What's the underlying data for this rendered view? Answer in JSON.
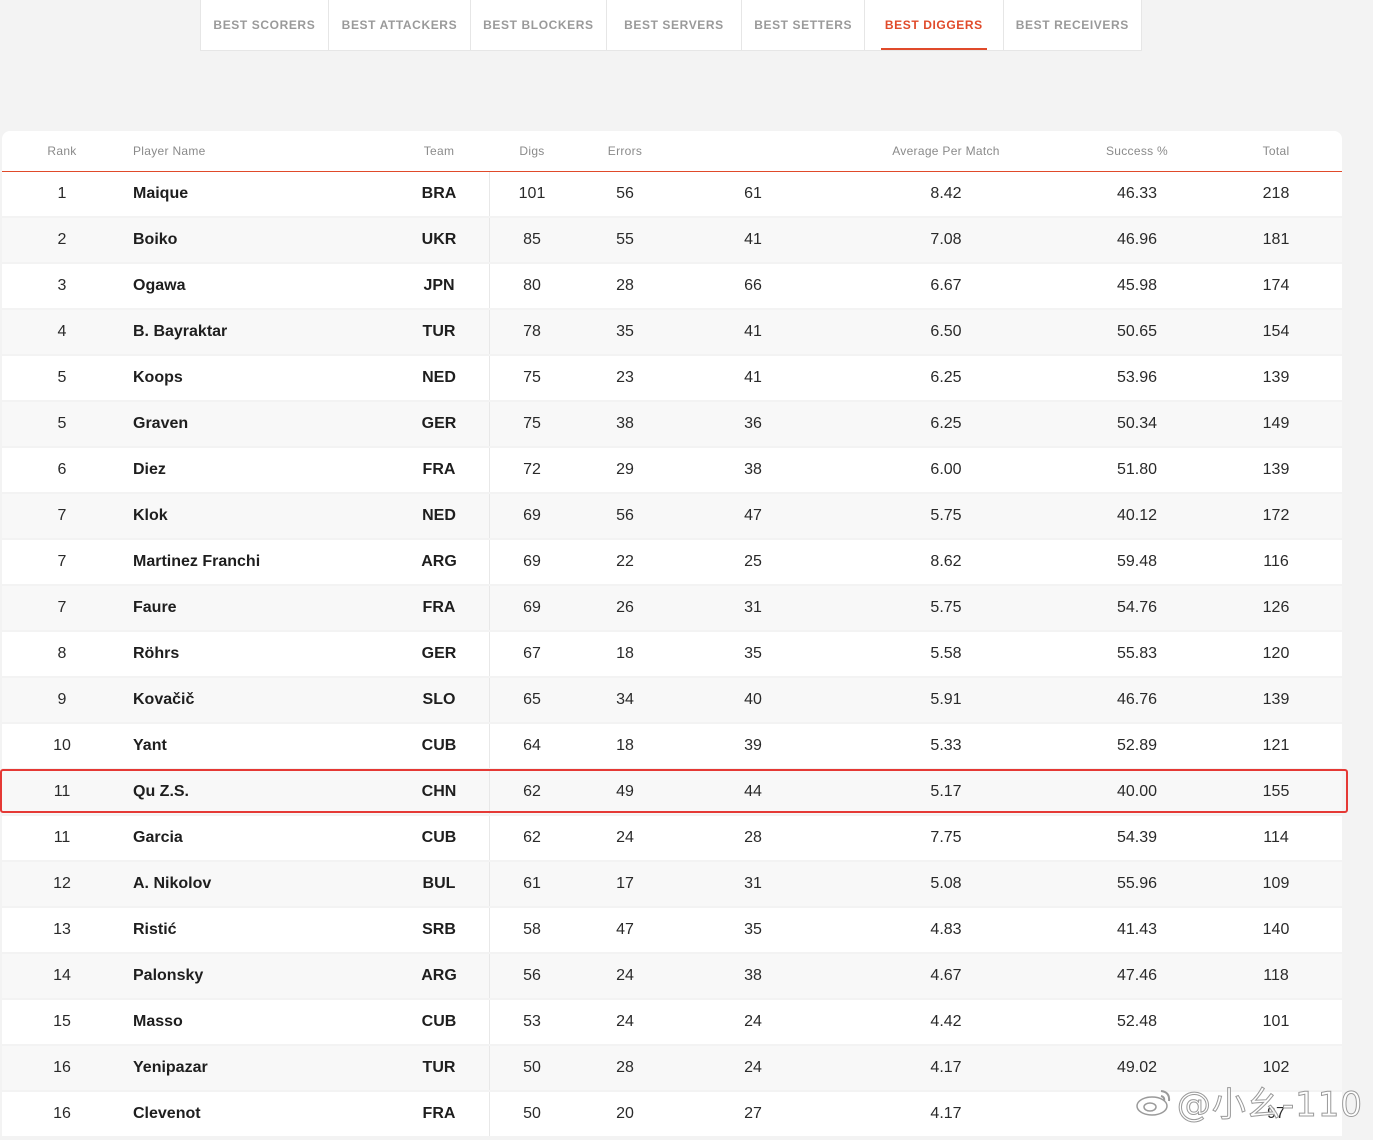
{
  "tabs": [
    {
      "label": "BEST SCORERS",
      "active": false
    },
    {
      "label": "BEST ATTACKERS",
      "active": false
    },
    {
      "label": "BEST BLOCKERS",
      "active": false
    },
    {
      "label": "BEST SERVERS",
      "active": false
    },
    {
      "label": "BEST SETTERS",
      "active": false
    },
    {
      "label": "BEST DIGGERS",
      "active": true
    },
    {
      "label": "BEST RECEIVERS",
      "active": false
    }
  ],
  "table": {
    "headers": {
      "rank": "Rank",
      "player": "Player Name",
      "team": "Team",
      "digs": "Digs",
      "errors": "Errors",
      "blurred": "",
      "avg": "Average Per Match",
      "success": "Success %",
      "total": "Total"
    },
    "rows": [
      {
        "rank": "1",
        "player": "Maique",
        "team": "BRA",
        "digs": "101",
        "errors": "56",
        "x": "61",
        "avg": "8.42",
        "success": "46.33",
        "total": "218"
      },
      {
        "rank": "2",
        "player": "Boiko",
        "team": "UKR",
        "digs": "85",
        "errors": "55",
        "x": "41",
        "avg": "7.08",
        "success": "46.96",
        "total": "181"
      },
      {
        "rank": "3",
        "player": "Ogawa",
        "team": "JPN",
        "digs": "80",
        "errors": "28",
        "x": "66",
        "avg": "6.67",
        "success": "45.98",
        "total": "174"
      },
      {
        "rank": "4",
        "player": "B. Bayraktar",
        "team": "TUR",
        "digs": "78",
        "errors": "35",
        "x": "41",
        "avg": "6.50",
        "success": "50.65",
        "total": "154"
      },
      {
        "rank": "5",
        "player": "Koops",
        "team": "NED",
        "digs": "75",
        "errors": "23",
        "x": "41",
        "avg": "6.25",
        "success": "53.96",
        "total": "139"
      },
      {
        "rank": "5",
        "player": "Graven",
        "team": "GER",
        "digs": "75",
        "errors": "38",
        "x": "36",
        "avg": "6.25",
        "success": "50.34",
        "total": "149"
      },
      {
        "rank": "6",
        "player": "Diez",
        "team": "FRA",
        "digs": "72",
        "errors": "29",
        "x": "38",
        "avg": "6.00",
        "success": "51.80",
        "total": "139"
      },
      {
        "rank": "7",
        "player": "Klok",
        "team": "NED",
        "digs": "69",
        "errors": "56",
        "x": "47",
        "avg": "5.75",
        "success": "40.12",
        "total": "172"
      },
      {
        "rank": "7",
        "player": "Martinez Franchi",
        "team": "ARG",
        "digs": "69",
        "errors": "22",
        "x": "25",
        "avg": "8.62",
        "success": "59.48",
        "total": "116"
      },
      {
        "rank": "7",
        "player": "Faure",
        "team": "FRA",
        "digs": "69",
        "errors": "26",
        "x": "31",
        "avg": "5.75",
        "success": "54.76",
        "total": "126"
      },
      {
        "rank": "8",
        "player": "Röhrs",
        "team": "GER",
        "digs": "67",
        "errors": "18",
        "x": "35",
        "avg": "5.58",
        "success": "55.83",
        "total": "120"
      },
      {
        "rank": "9",
        "player": "Kovačič",
        "team": "SLO",
        "digs": "65",
        "errors": "34",
        "x": "40",
        "avg": "5.91",
        "success": "46.76",
        "total": "139"
      },
      {
        "rank": "10",
        "player": "Yant",
        "team": "CUB",
        "digs": "64",
        "errors": "18",
        "x": "39",
        "avg": "5.33",
        "success": "52.89",
        "total": "121"
      },
      {
        "rank": "11",
        "player": "Qu Z.S.",
        "team": "CHN",
        "digs": "62",
        "errors": "49",
        "x": "44",
        "avg": "5.17",
        "success": "40.00",
        "total": "155"
      },
      {
        "rank": "11",
        "player": "Garcia",
        "team": "CUB",
        "digs": "62",
        "errors": "24",
        "x": "28",
        "avg": "7.75",
        "success": "54.39",
        "total": "114"
      },
      {
        "rank": "12",
        "player": "A. Nikolov",
        "team": "BUL",
        "digs": "61",
        "errors": "17",
        "x": "31",
        "avg": "5.08",
        "success": "55.96",
        "total": "109"
      },
      {
        "rank": "13",
        "player": "Ristić",
        "team": "SRB",
        "digs": "58",
        "errors": "47",
        "x": "35",
        "avg": "4.83",
        "success": "41.43",
        "total": "140"
      },
      {
        "rank": "14",
        "player": "Palonsky",
        "team": "ARG",
        "digs": "56",
        "errors": "24",
        "x": "38",
        "avg": "4.67",
        "success": "47.46",
        "total": "118"
      },
      {
        "rank": "15",
        "player": "Masso",
        "team": "CUB",
        "digs": "53",
        "errors": "24",
        "x": "24",
        "avg": "4.42",
        "success": "52.48",
        "total": "101"
      },
      {
        "rank": "16",
        "player": "Yenipazar",
        "team": "TUR",
        "digs": "50",
        "errors": "28",
        "x": "24",
        "avg": "4.17",
        "success": "49.02",
        "total": "102"
      },
      {
        "rank": "16",
        "player": "Clevenot",
        "team": "FRA",
        "digs": "50",
        "errors": "20",
        "x": "27",
        "avg": "4.17",
        "success": "",
        "total": "97"
      }
    ]
  },
  "watermark": {
    "text": "@小幺-110"
  },
  "colors": {
    "accent": "#e04a2a",
    "highlight_border": "#e53935",
    "page_bg": "#f3f3f3"
  }
}
